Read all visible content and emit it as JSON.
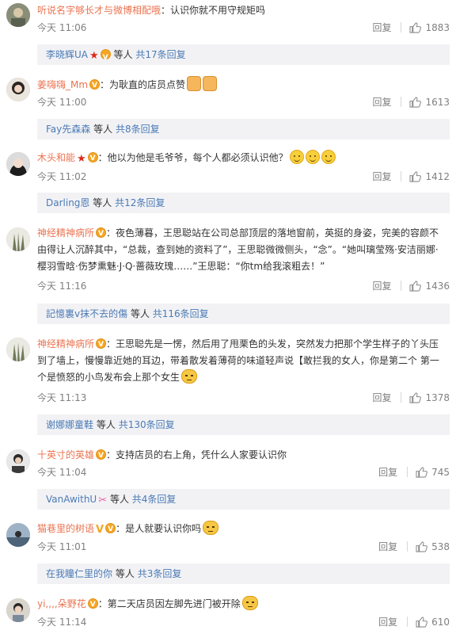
{
  "comments": [
    {
      "username": "听说名字够长才与微博相配哦",
      "text": "：认识你就不用守规矩吗",
      "time": "今天 11:06",
      "reply": "回复",
      "likes": "1883",
      "sub": {
        "user": "李晓辉UA",
        "mid": "等人",
        "count": "共17条回复"
      }
    },
    {
      "username": "姜嗨嗨_Mm",
      "text": "：为耿直的店员点赞",
      "time": "今天 11:00",
      "reply": "回复",
      "likes": "1613",
      "sub": {
        "user": "Fay先森森",
        "mid": "等人",
        "count": "共8条回复"
      }
    },
    {
      "username": "木头和能",
      "text": "：他以为他是毛爷爷，每个人都必须认识他？",
      "time": "今天 11:02",
      "reply": "回复",
      "likes": "1412",
      "sub": {
        "user": "Darling恩",
        "mid": "等人",
        "count": "共12条回复"
      }
    },
    {
      "username": "神经精神病所",
      "text": "：夜色薄暮，王思聪站在公司总部顶层的落地窗前，英挺的身姿，完美的容颜不由得让人沉醉其中，“总裁，查到她的资料了”，王思聪微微侧头，“念”。“她叫璃莹殇·安洁丽娜·樱羽雪晗·伤梦熏魅·J·Q·蔷薇玫瑰……”王思聪：“你tm给我滚粗去！”",
      "time": "今天 11:16",
      "reply": "回复",
      "likes": "1436",
      "sub": {
        "user": "記憶裏v抹不去的傷",
        "mid": "等人",
        "count": "共116条回复"
      }
    },
    {
      "username": "神经精神病所",
      "text": "：王思聪先是一愣，然后用了甩栗色的头发，突然发力把那个学生样子的丫头压到了墙上，慢慢靠近她的耳边，带着散发着薄荷的味道轻声说【敢拦我的女人，你是第二个 第一个是愤怒的小鸟发布会上那个女生",
      "time": "今天 11:13",
      "reply": "回复",
      "likes": "1378",
      "sub": {
        "user": "谢娜娜童鞋",
        "mid": "等人",
        "count": "共130条回复"
      }
    },
    {
      "username": "十英寸的英雄",
      "text": "：支持店员的右上角，凭什么人家要认识你",
      "time": "今天 11:04",
      "reply": "回复",
      "likes": "745",
      "sub": {
        "user": "VanAwithU",
        "mid": "等人",
        "count": "共4条回复"
      }
    },
    {
      "username": "猫巷里的树语",
      "text": "：是人就要认识你吗",
      "time": "今天 11:01",
      "reply": "回复",
      "likes": "538",
      "sub": {
        "user": "在我瞳仁里的你",
        "mid": "等人",
        "count": "共3条回复"
      }
    },
    {
      "username": "yi,,,,朵野花",
      "text": "：第二天店员因左脚先进门被开除",
      "time": "今天 11:14",
      "reply": "回复",
      "likes": "610"
    }
  ],
  "colors": {
    "username": "#eb7350",
    "link": "#4b7bb5",
    "meta": "#808080",
    "subbox": "#f2f2f5"
  }
}
